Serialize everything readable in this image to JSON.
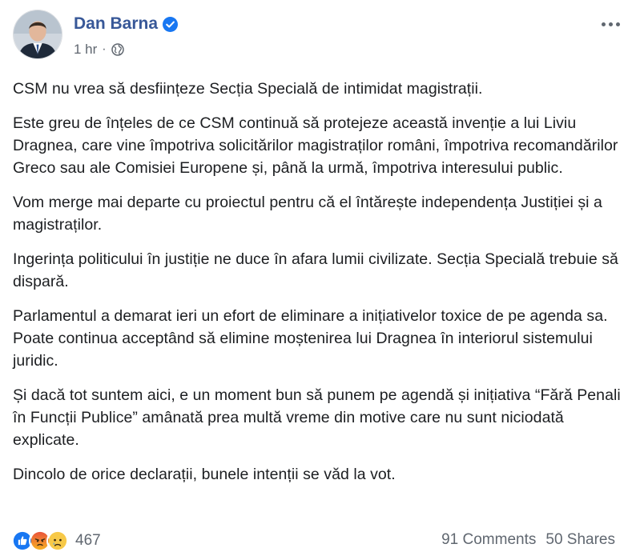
{
  "post": {
    "author": "Dan Barna",
    "time": "1 hr",
    "separator": "·",
    "icons": {
      "avatar": "profile-photo",
      "verified": "verified-badge-icon",
      "audience": "globe-icon",
      "more": "more-options-icon"
    },
    "colors": {
      "author": "#385898",
      "verified": "#1877f2",
      "text": "#1c1e21",
      "secondary": "#606770"
    },
    "paragraphs": [
      "CSM nu vrea să desființeze Secția Specială de intimidat magistrații.",
      "Este greu de înțeles de ce CSM continuă să protejeze această invenție a lui Liviu Dragnea, care vine împotriva solicitărilor magistraților români, împotriva recomandărilor Greco sau ale Comisiei Europene și, până la urmă, împotriva interesului public.",
      "Vom merge mai departe cu proiectul pentru că el întărește independența Justiției și a magistraților.",
      "Ingerința politicului în justiție ne duce în afara lumii civilizate. Secția Specială trebuie să dispară.",
      "Parlamentul a demarat ieri un efort de eliminare a inițiativelor toxice de pe agenda sa. Poate continua acceptând să elimine moștenirea lui Dragnea în interiorul sistemului juridic.",
      "Și dacă tot suntem aici, e un moment bun să punem pe agendă și inițiativa “Fără Penali în Funcții Publice” amânată prea multă vreme din motive care nu sunt niciodată explicate.",
      "Dincolo de orice declarații, bunele intenții se văd la vot."
    ]
  },
  "footer": {
    "reactions": [
      "like-reaction-icon",
      "angry-reaction-icon",
      "sad-reaction-icon"
    ],
    "reaction_count": "467",
    "comments": "91 Comments",
    "shares": "50 Shares"
  }
}
